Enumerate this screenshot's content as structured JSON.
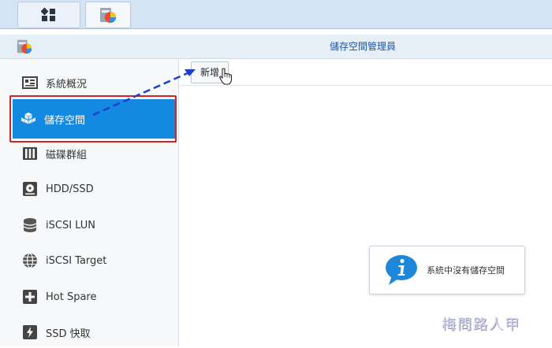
{
  "window": {
    "title": "儲存空間管理員"
  },
  "toolbar": {
    "add_label": "新增"
  },
  "sidebar": {
    "items": [
      {
        "label": "系統概況",
        "icon": "overview-icon"
      },
      {
        "label": "儲存空間",
        "icon": "storage-cubes-icon",
        "active": true
      },
      {
        "label": "磁碟群組",
        "icon": "disk-group-icon"
      },
      {
        "label": "HDD/SSD",
        "icon": "hdd-icon"
      },
      {
        "label": "iSCSI LUN",
        "icon": "database-icon"
      },
      {
        "label": "iSCSI Target",
        "icon": "globe-icon"
      },
      {
        "label": "Hot Spare",
        "icon": "hot-spare-icon"
      },
      {
        "label": "SSD 快取",
        "icon": "ssd-cache-icon"
      }
    ]
  },
  "notice": {
    "text": "系統中沒有儲存空間"
  },
  "watermark": {
    "text": "梅問路人甲"
  },
  "colors": {
    "accent": "#1489e2",
    "highlight_border": "#d32222",
    "title": "#1a56a6"
  }
}
